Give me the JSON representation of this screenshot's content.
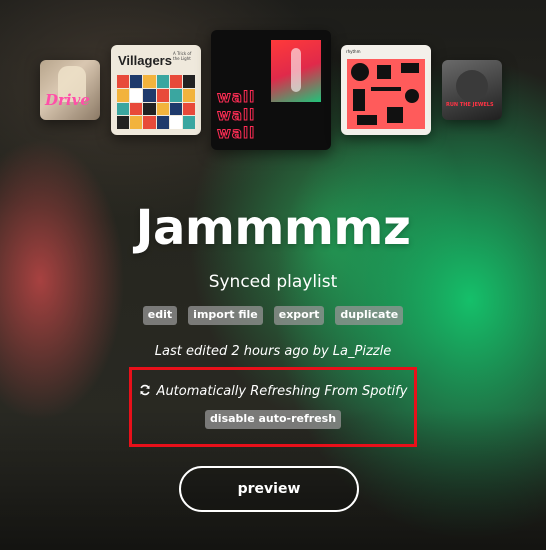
{
  "covers": [
    {
      "name": "drive",
      "text": "Drive"
    },
    {
      "name": "villagers",
      "text": "Villagers",
      "subtext": "A Trick of the Light"
    },
    {
      "name": "wall",
      "text": "wall"
    },
    {
      "name": "geometric",
      "text": "rhythm"
    },
    {
      "name": "dark",
      "text": "RUN THE JEWELS"
    }
  ],
  "playlist": {
    "title": "Jammmmz",
    "subtitle": "Synced playlist"
  },
  "actions": {
    "edit": "edit",
    "import_file": "import file",
    "export": "export",
    "duplicate": "duplicate"
  },
  "meta": {
    "last_edited": "Last edited 2 hours ago by La_Pizzle"
  },
  "sync": {
    "icon": "refresh-icon",
    "status": "Automatically Refreshing From Spotify",
    "disable_label": "disable auto-refresh",
    "highlight_color": "#e8101a"
  },
  "preview_label": "preview",
  "colors": {
    "accent_green": "#14c86e",
    "pill_bg": "#969696"
  }
}
